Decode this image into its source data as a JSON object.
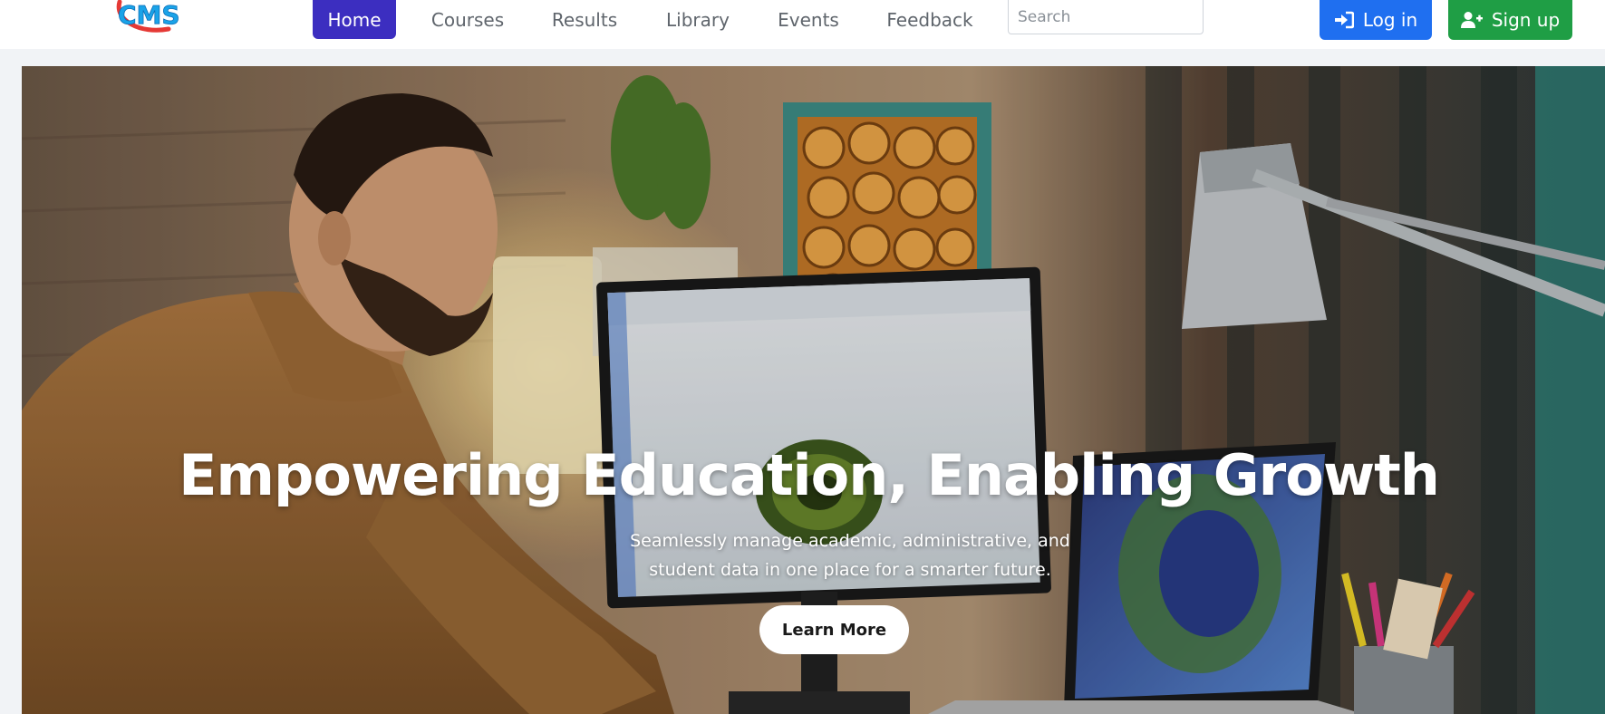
{
  "brand": {
    "logo_text": "CMS",
    "colors": {
      "logo_blue": "#1aa3e8",
      "logo_red": "#e53935"
    }
  },
  "nav": {
    "items": [
      {
        "label": "Home",
        "active": true
      },
      {
        "label": "Courses",
        "active": false
      },
      {
        "label": "Results",
        "active": false
      },
      {
        "label": "Library",
        "active": false
      },
      {
        "label": "Events",
        "active": false
      },
      {
        "label": "Feedback",
        "active": false
      }
    ],
    "active_color": "#3c2ec0"
  },
  "search": {
    "placeholder": "Search",
    "value": ""
  },
  "auth": {
    "login": {
      "label": "Log in",
      "icon": "sign-in-icon",
      "color": "#1f6ff0"
    },
    "signup": {
      "label": "Sign up",
      "icon": "user-plus-icon",
      "color": "#1f9e45"
    }
  },
  "hero": {
    "title": "Empowering Education, Enabling Growth",
    "subtitle": "Seamlessly manage academic, administrative, and student data in one place for a smarter future.",
    "cta_label": "Learn More",
    "image_description_icon": "office-photo-image"
  }
}
